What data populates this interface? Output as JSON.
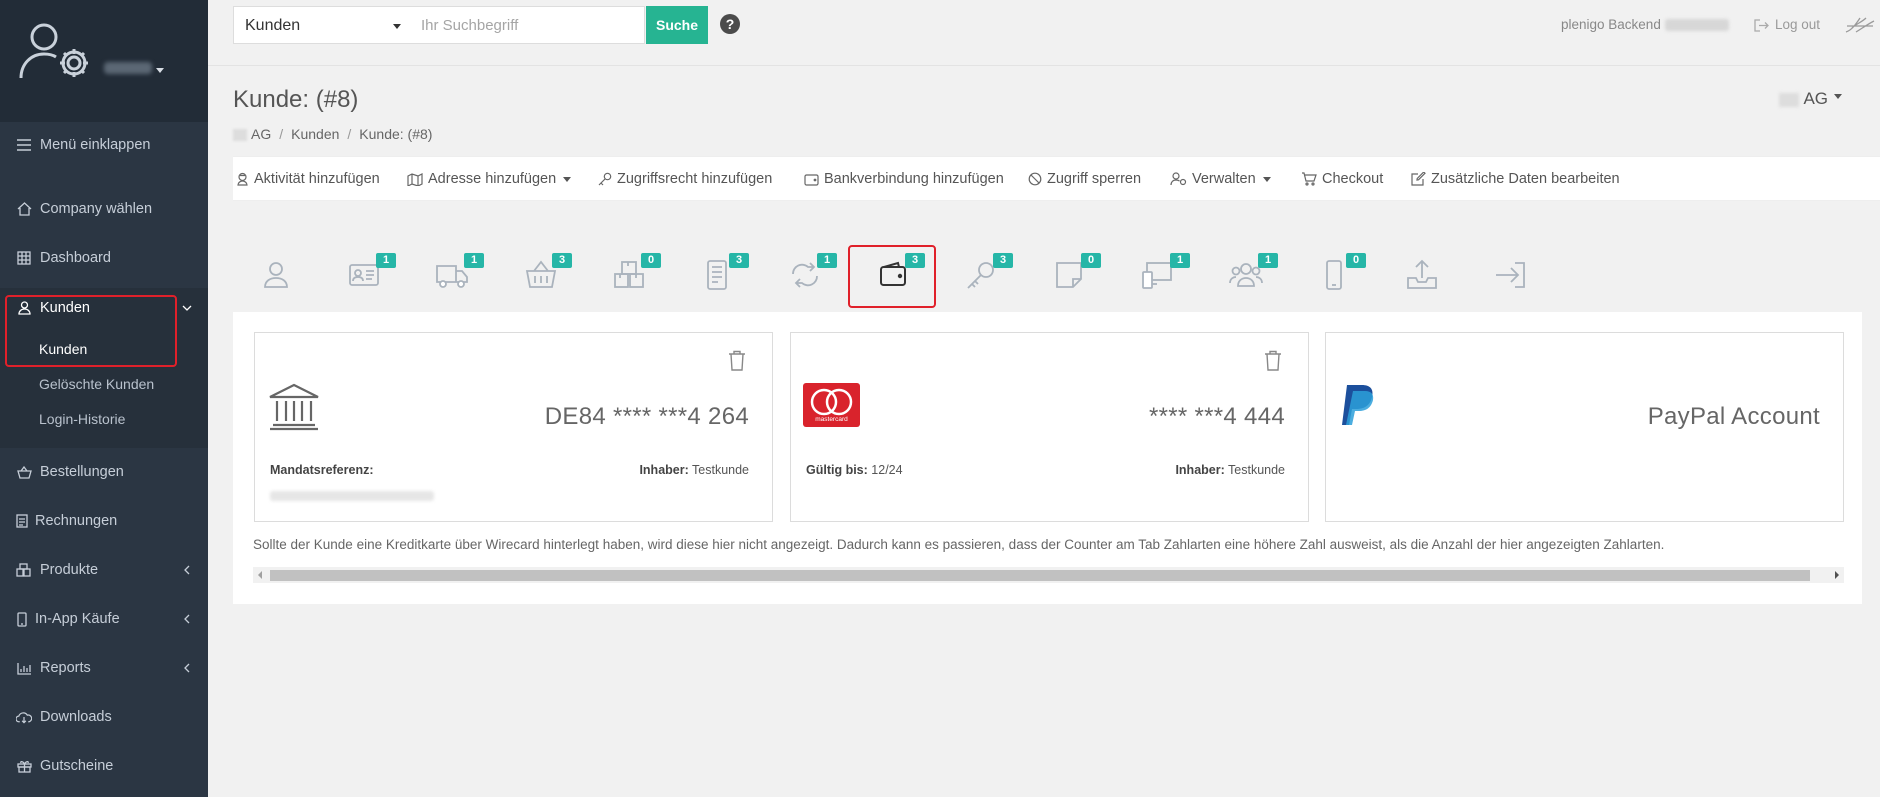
{
  "sidebar": {
    "collapse_label": "Menü einklappen",
    "items": [
      {
        "label": "Company wählen",
        "icon": "home-icon"
      },
      {
        "label": "Dashboard",
        "icon": "grid-icon"
      },
      {
        "label": "Kunden",
        "icon": "user-icon"
      },
      {
        "label": "Bestellungen",
        "icon": "basket-icon"
      },
      {
        "label": "Rechnungen",
        "icon": "invoice-icon"
      },
      {
        "label": "Produkte",
        "icon": "box-icon"
      },
      {
        "label": "In-App Käufe",
        "icon": "phone-icon"
      },
      {
        "label": "Reports",
        "icon": "chart-icon"
      },
      {
        "label": "Downloads",
        "icon": "download-icon"
      },
      {
        "label": "Gutscheine",
        "icon": "gift-icon"
      }
    ],
    "kunden_sub": [
      "Kunden",
      "Gelöschte Kunden",
      "Login-Historie"
    ]
  },
  "topbar": {
    "select_value": "Kunden",
    "search_placeholder": "Ihr Suchbegriff",
    "search_button": "Suche",
    "help": "?",
    "backend_label": "plenigo Backend",
    "logout_label": "Log out"
  },
  "page": {
    "title": "Kunde: (#8)",
    "company_suffix": "AG",
    "breadcrumb": [
      "AG",
      "Kunden",
      "Kunde: (#8)"
    ]
  },
  "actions": [
    "Aktivität hinzufügen",
    "Adresse hinzufügen",
    "Zugriffsrecht hinzufügen",
    "Bankverbindung hinzufügen",
    "Zugriff sperren",
    "Verwalten",
    "Checkout",
    "Zusätzliche Daten bearbeiten"
  ],
  "tabs": [
    {
      "icon": "user-icon",
      "badge": ""
    },
    {
      "icon": "id-card-icon",
      "badge": "1"
    },
    {
      "icon": "truck-icon",
      "badge": "1"
    },
    {
      "icon": "basket-icon",
      "badge": "3"
    },
    {
      "icon": "boxes-icon",
      "badge": "0"
    },
    {
      "icon": "invoice-icon",
      "badge": "3"
    },
    {
      "icon": "refresh-icon",
      "badge": "1"
    },
    {
      "icon": "wallet-icon",
      "badge": "3"
    },
    {
      "icon": "key-icon",
      "badge": "3"
    },
    {
      "icon": "note-icon",
      "badge": "0"
    },
    {
      "icon": "devices-icon",
      "badge": "1"
    },
    {
      "icon": "users-icon",
      "badge": "1"
    },
    {
      "icon": "mobile-icon",
      "badge": "0"
    },
    {
      "icon": "upload-icon",
      "badge": ""
    },
    {
      "icon": "login-icon",
      "badge": ""
    }
  ],
  "cards": {
    "bank": {
      "number": "DE84 **** ***4 264",
      "mandate_label": "Mandatsreferenz:",
      "owner_label": "Inhaber:",
      "owner": "Testkunde"
    },
    "credit": {
      "number": "**** ***4 444",
      "brand": "mastercard",
      "valid_label": "Gültig bis:",
      "valid": "12/24",
      "owner_label": "Inhaber:",
      "owner": "Testkunde"
    },
    "paypal": {
      "label": "PayPal Account"
    }
  },
  "note": "Sollte der Kunde eine Kreditkarte über Wirecard hinterlegt haben, wird diese hier nicht angezeigt. Dadurch kann es passieren, dass der Counter am Tab Zahlarten eine höhere Zahl ausweist, als die Anzahl der hier angezeigten Zahlarten.",
  "colors": {
    "sidebar": "#2b3643",
    "accent": "#26b492",
    "badge": "#26b6a7",
    "highlight": "#e0202a",
    "paypal": "#1c4f9c",
    "mastercard": "#d9232c"
  }
}
